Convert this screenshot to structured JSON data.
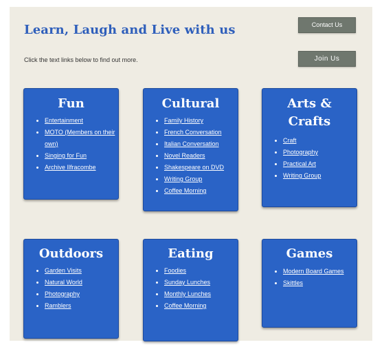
{
  "header": {
    "title": "Learn, Laugh and Live with us",
    "subtitle": "Click the text links below to find out more.",
    "contact_label": "Contact Us",
    "join_label": "Join Us"
  },
  "cards": [
    {
      "title_lines": [
        "Fun"
      ],
      "links": [
        "Entertainment",
        "MOTO (Members on their own)",
        "Singing for Fun",
        "Archive Ilfracombe"
      ]
    },
    {
      "title_lines": [
        "Cultural"
      ],
      "links": [
        "Family History",
        "French Conversation",
        "Italian Conversation",
        "Novel Readers",
        "Shakespeare on DVD",
        "Writing Group",
        "Coffee Morning"
      ]
    },
    {
      "title_lines": [
        "Arts &",
        "Crafts"
      ],
      "links": [
        "Craft",
        "Photography",
        "Practical Art",
        "Writing Group"
      ]
    },
    {
      "title_lines": [
        "Outdoors"
      ],
      "links": [
        "Garden Visits",
        "Natural World",
        "Photography",
        "Ramblers"
      ]
    },
    {
      "title_lines": [
        "Eating"
      ],
      "links": [
        "Foodies",
        "Sunday Lunches",
        "Monthly Lunches",
        "Coffee Morning"
      ]
    },
    {
      "title_lines": [
        "Games"
      ],
      "links": [
        "Modern Board Games",
        "Skittles"
      ]
    }
  ]
}
